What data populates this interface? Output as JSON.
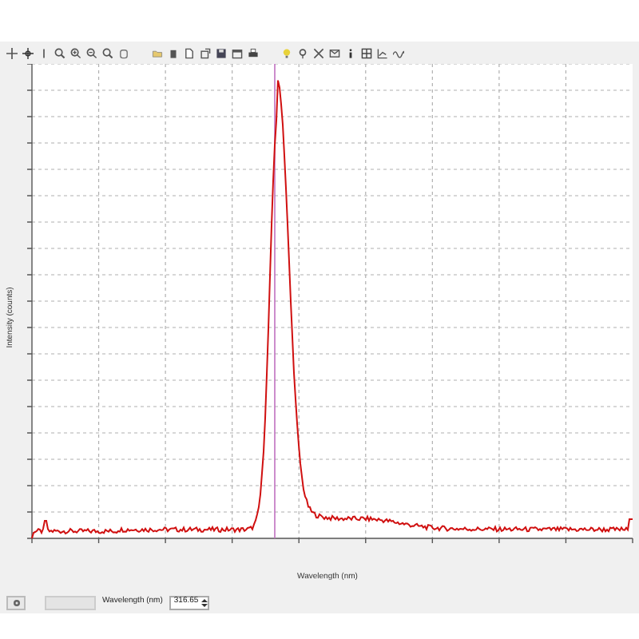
{
  "plot": {
    "ylabel": "Intensity (counts)",
    "xlabel": "Wavelength (nm)"
  },
  "footer": {
    "field_label": "Wavelength (nm)",
    "value": "316.65"
  }
}
